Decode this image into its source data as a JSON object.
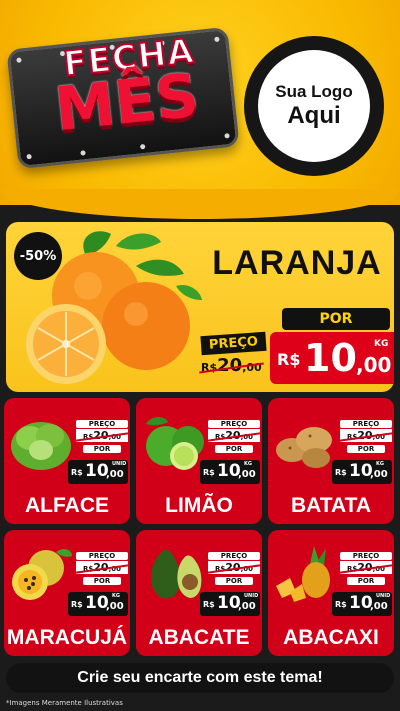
{
  "header": {
    "title_line1": "FECHA",
    "title_line2": "MÊS",
    "logo_line1": "Sua Logo",
    "logo_line2": "Aqui"
  },
  "featured": {
    "discount": "-50%",
    "name": "LARANJA",
    "old_label": "PREÇO",
    "old_currency": "R$",
    "old_int": "20",
    "old_dec": ",00",
    "new_label": "POR",
    "new_currency": "R$",
    "new_int": "10",
    "new_dec": ",00",
    "unit": "KG",
    "image_icon": "orange-icon"
  },
  "products": [
    {
      "name": "ALFACE",
      "old_label": "PREÇO",
      "old_currency": "R$",
      "old_int": "20",
      "old_dec": ",00",
      "new_label": "POR",
      "currency": "R$",
      "int": "10",
      "dec": ",00",
      "unit": "UNID",
      "icon": "lettuce-icon"
    },
    {
      "name": "LIMÃO",
      "old_label": "PREÇO",
      "old_currency": "R$",
      "old_int": "20",
      "old_dec": ",00",
      "new_label": "POR",
      "currency": "R$",
      "int": "10",
      "dec": ",00",
      "unit": "KG",
      "icon": "lime-icon"
    },
    {
      "name": "BATATA",
      "old_label": "PREÇO",
      "old_currency": "R$",
      "old_int": "20",
      "old_dec": ",00",
      "new_label": "POR",
      "currency": "R$",
      "int": "10",
      "dec": ",00",
      "unit": "KG",
      "icon": "potato-icon"
    },
    {
      "name": "MARACUJÁ",
      "old_label": "PREÇO",
      "old_currency": "R$",
      "old_int": "20",
      "old_dec": ",00",
      "new_label": "POR",
      "currency": "R$",
      "int": "10",
      "dec": ",00",
      "unit": "KG",
      "icon": "passion-fruit-icon"
    },
    {
      "name": "ABACATE",
      "old_label": "PREÇO",
      "old_currency": "R$",
      "old_int": "20",
      "old_dec": ",00",
      "new_label": "POR",
      "currency": "R$",
      "int": "10",
      "dec": ",00",
      "unit": "UNID",
      "icon": "avocado-icon"
    },
    {
      "name": "ABACAXI",
      "old_label": "PREÇO",
      "old_currency": "R$",
      "old_int": "20",
      "old_dec": ",00",
      "new_label": "POR",
      "currency": "R$",
      "int": "10",
      "dec": ",00",
      "unit": "UNID",
      "icon": "pineapple-icon"
    }
  ],
  "footer": {
    "cta": "Crie seu encarte com este tema!",
    "disclaimer": "*Imagens Meramente Ilustrativas"
  },
  "colors": {
    "yellow": "#f9b800",
    "red": "#d10018",
    "black": "#1b1b1b"
  }
}
